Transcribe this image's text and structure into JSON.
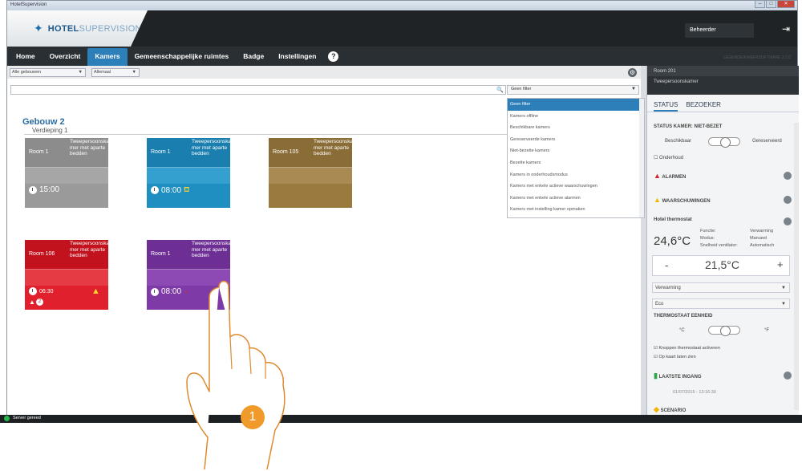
{
  "window": {
    "title": "HotelSupervision"
  },
  "header": {
    "logo_main": "HOTEL",
    "logo_sub": "SUPERVISION",
    "user": "Beheerder"
  },
  "nav": {
    "tabs": [
      {
        "label": "Home"
      },
      {
        "label": "Overzicht"
      },
      {
        "label": "Kamers"
      },
      {
        "label": "Gemeenschappelijke ruimtes"
      },
      {
        "label": "Badge"
      },
      {
        "label": "Instellingen"
      }
    ],
    "legend": "LEGENDE/KAMERSOFTWARE 2.1.0"
  },
  "toolbar": {
    "building_select": "Alle gebouwen",
    "floor_select": "Allemaal"
  },
  "filter": {
    "selected": "Geen filter",
    "options": [
      "Geen filter",
      "Kamers offline",
      "Beschikbare kamers",
      "Gereserveerde kamers",
      "Niet-bezette kamers",
      "Bezette kamers",
      "Kamers in onderhoudsmodus",
      "Kamers met enkele actieve waarschuwingen",
      "Kamers met enkele actieve alarmen",
      "Kamers met instelling kamer opmaken"
    ]
  },
  "building": {
    "name": "Gebouw 2",
    "floor": "Verdieping 1"
  },
  "rooms": [
    {
      "name": "Room 1",
      "type": "Tweepersoonska mer met aparte bedden",
      "time": "15:00",
      "color": "#9a9a9a"
    },
    {
      "name": "Room 1",
      "type": "Tweepersoonska mer met aparte bedden",
      "time": "08:00",
      "color": "#1f8fc1"
    },
    {
      "name": "Room 105",
      "type": "Tweepersoonska mer met aparte bedden",
      "time": "",
      "color": "#9b7a3f"
    },
    {
      "name": "Room 106",
      "type": "Tweepersoonska mer met aparte bedden",
      "time": "06:30",
      "alarm_count": "2",
      "color": "#d4212c"
    },
    {
      "name": "Room 1",
      "type": "Tweepersoonska mer met aparte bedden",
      "time": "08:00",
      "color": "#7e3aa6"
    }
  ],
  "panel": {
    "room": "Room 201",
    "room_type": "Tweepersoonskamer",
    "tab_status": "STATUS",
    "tab_visitor": "BEZOEKER",
    "status_title": "STATUS KAMER: NIET-BEZET",
    "available": "Beschikbaar",
    "reserved": "Gereserveerd",
    "maintenance": "Onderhoud",
    "alarms": "ALARMEN",
    "warnings": "WAARSCHUWINGEN",
    "thermostat": "Hotel thermostat",
    "temp_actual": "24,6°C",
    "func_label": "Functie:",
    "func_value": "Verwarming",
    "mode_label": "Modus:",
    "mode_value": "Manueel",
    "fan_label": "Snelheid ventilator:",
    "fan_value": "Automatisch",
    "minus": "-",
    "setpoint": "21,5°C",
    "plus": "+",
    "select_mode": "Verwarming",
    "select_eco": "Eco",
    "unit_title": "THERMOSTAAT EENHEID",
    "unit_c": "°C",
    "unit_f": "°F",
    "check1": "Knoppen thermostaat activeren",
    "check2": "Op kaart laten zien",
    "last_entry": "LAATSTE INGANG",
    "last_entry_time": "01/07/2015 - 13:16:30",
    "scenario": "SCENARIO"
  },
  "status_bar": {
    "text": "Server gereed"
  },
  "callout": {
    "number": "1"
  }
}
